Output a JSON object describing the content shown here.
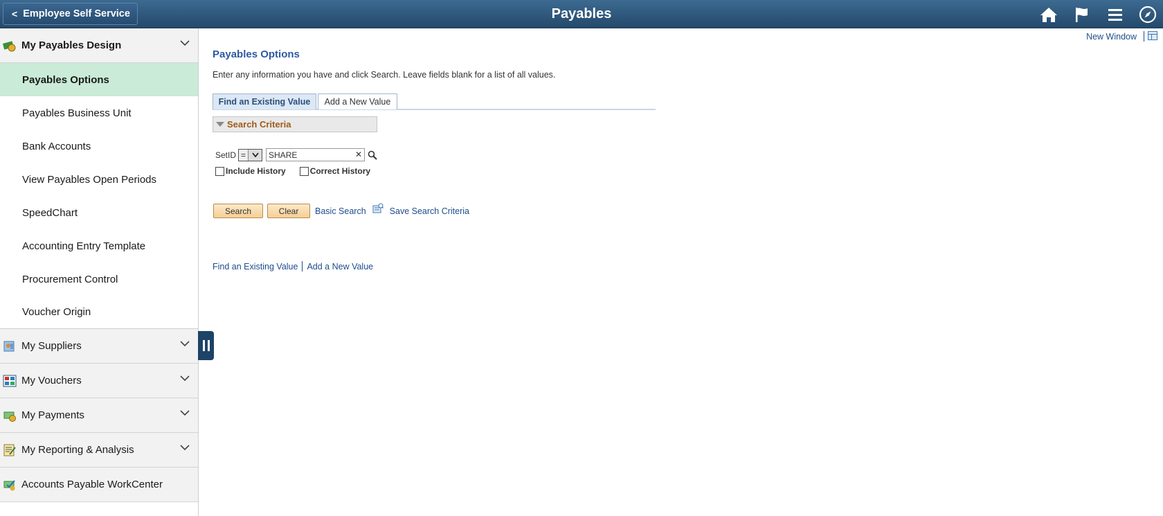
{
  "header": {
    "back_label": "Employee Self Service",
    "title": "Payables",
    "icons": [
      "home-icon",
      "flag-icon",
      "menu-icon",
      "navbar-compass-icon"
    ]
  },
  "sidebar": {
    "expanded_section": {
      "label": "My Payables Design",
      "icon": "payables-design-icon",
      "items": [
        {
          "label": "Payables Options",
          "active": true
        },
        {
          "label": "Payables Business Unit"
        },
        {
          "label": "Bank Accounts"
        },
        {
          "label": "View Payables Open Periods"
        },
        {
          "label": "SpeedChart"
        },
        {
          "label": "Accounting Entry Template"
        },
        {
          "label": "Procurement Control"
        },
        {
          "label": "Voucher Origin"
        }
      ]
    },
    "sections": [
      {
        "label": "My Suppliers",
        "icon": "suppliers-icon"
      },
      {
        "label": "My Vouchers",
        "icon": "vouchers-icon"
      },
      {
        "label": "My Payments",
        "icon": "payments-icon"
      },
      {
        "label": "My Reporting & Analysis",
        "icon": "reporting-icon"
      },
      {
        "label": "Accounts Payable WorkCenter",
        "icon": "workcenter-icon"
      }
    ]
  },
  "main": {
    "new_window": "New Window",
    "title": "Payables Options",
    "instructions": "Enter any information you have and click Search. Leave fields blank for a list of all values.",
    "tabs": {
      "find": "Find an Existing Value",
      "add": "Add a New Value"
    },
    "criteria_header": "Search Criteria",
    "setid_label": "SetID",
    "operator": "=",
    "setid_value": "SHARE",
    "include_history": "Include History",
    "correct_history": "Correct History",
    "search_btn": "Search",
    "clear_btn": "Clear",
    "basic_search": "Basic Search",
    "save_search": "Save Search Criteria",
    "bottom_find": "Find an Existing Value",
    "bottom_add": "Add a New Value"
  }
}
